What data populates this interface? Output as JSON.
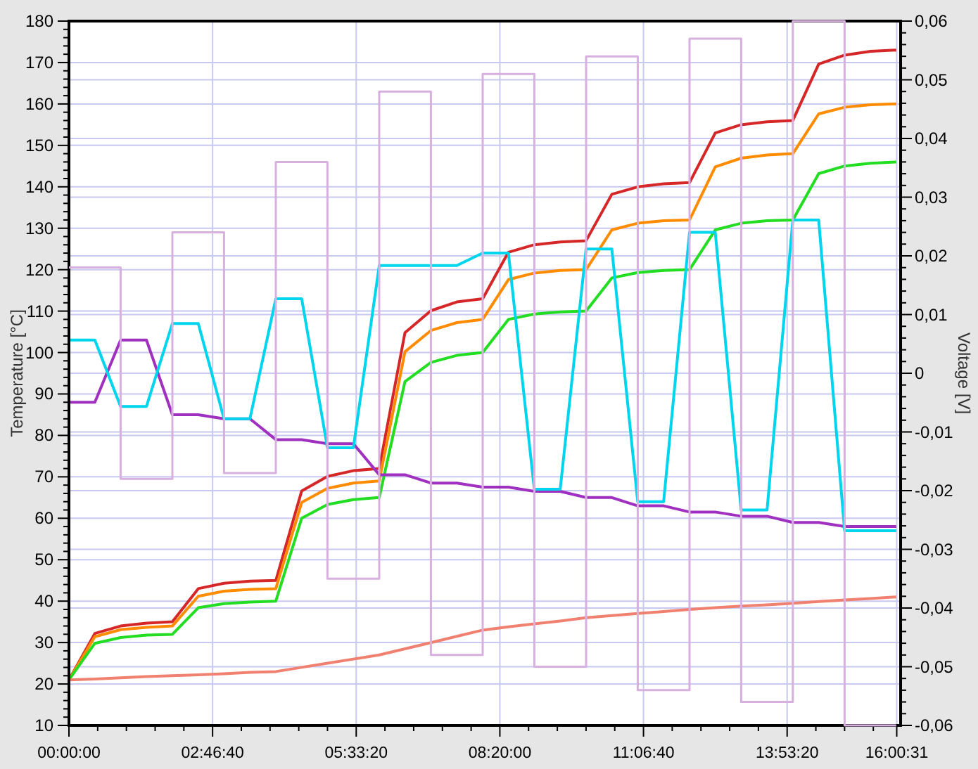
{
  "temperature_chart": {
    "chart_data": {
      "type": "line",
      "ylabel": "Temperature [°C]",
      "x": [
        0,
        1800,
        3600,
        5400,
        7200,
        9000,
        10800,
        12600,
        14400,
        16200,
        18000,
        19800,
        21600,
        23400,
        25200,
        27000,
        28800,
        30600,
        32400,
        34200,
        36000,
        37800,
        39600,
        41400,
        43200,
        45000,
        46800,
        48600,
        50400,
        52200,
        54000,
        55800,
        57600
      ],
      "xlim": [
        0,
        57900
      ],
      "ylim": [
        10,
        180
      ],
      "grid": true,
      "xticks": [
        {
          "value": 0,
          "label": "00:00:00"
        },
        {
          "value": 10000,
          "label": "02:46:40"
        },
        {
          "value": 20000,
          "label": "05:33:20"
        },
        {
          "value": 30000,
          "label": "08:20:00"
        },
        {
          "value": 40000,
          "label": "11:06:40"
        },
        {
          "value": 50000,
          "label": "13:53:20"
        },
        {
          "value": 57631,
          "label": "16:00:31"
        }
      ],
      "yticks": [
        10,
        20,
        30,
        40,
        50,
        60,
        70,
        80,
        90,
        100,
        110,
        120,
        130,
        140,
        150,
        160,
        170,
        180
      ],
      "series": [
        {
          "color": "#d62728",
          "values": [
            21,
            32.2,
            34,
            34.7,
            35,
            43,
            44.3,
            44.8,
            45,
            66.6,
            70.1,
            71.5,
            72,
            104.8,
            110.1,
            112.2,
            113,
            124.2,
            126,
            126.7,
            127,
            138.2,
            140,
            140.7,
            141,
            153,
            155,
            155.7,
            156,
            169.6,
            171.8,
            172.7,
            173
          ]
        },
        {
          "color": "#ff8c00",
          "values": [
            21,
            31.4,
            33.1,
            33.7,
            34,
            41.2,
            42.4,
            42.8,
            43,
            63.8,
            67.2,
            68.5,
            69,
            100.2,
            105.3,
            107.2,
            108,
            117.6,
            119.2,
            119.8,
            120,
            129.6,
            131.2,
            131.8,
            132,
            144.8,
            146.9,
            147.7,
            148,
            157.6,
            159.2,
            159.8,
            160
          ]
        },
        {
          "color": "#22dd22",
          "values": [
            21,
            29.8,
            31.2,
            31.8,
            32,
            38.4,
            39.4,
            39.8,
            40,
            60,
            63.3,
            64.5,
            65,
            93,
            97.6,
            99.3,
            100,
            108,
            109.3,
            109.8,
            110,
            118,
            119.3,
            119.8,
            120,
            129.6,
            131.2,
            131.8,
            132,
            143.2,
            145,
            145.7,
            146
          ]
        },
        {
          "color": "#f08070",
          "values": [
            21,
            21.2,
            21.5,
            21.8,
            22,
            22.2,
            22.5,
            22.8,
            23,
            24,
            25,
            26,
            27,
            28.5,
            30,
            31.5,
            33,
            33.8,
            34.5,
            35.2,
            36,
            36.5,
            37,
            37.5,
            38,
            38.4,
            38.8,
            39.1,
            39.5,
            39.9,
            40.3,
            40.6,
            41
          ]
        },
        {
          "color": "#a030c0",
          "values": [
            88,
            88,
            103,
            103,
            85,
            85,
            84,
            84,
            79,
            79,
            78,
            78,
            70.5,
            70.5,
            68.5,
            68.5,
            67.5,
            67.5,
            66.5,
            66.5,
            65,
            65,
            63,
            63,
            61.5,
            61.5,
            60.5,
            60.5,
            59,
            59,
            58,
            58,
            58
          ]
        },
        {
          "color": "#00d5ee",
          "values": [
            103,
            103,
            87,
            87,
            107,
            107,
            84,
            84,
            113,
            113,
            77,
            77,
            121,
            121,
            121,
            121,
            124,
            124,
            67,
            67,
            125,
            125,
            64,
            64,
            129,
            129,
            62,
            62,
            132,
            132,
            57,
            57,
            57
          ]
        }
      ]
    }
  },
  "voltage_chart": {
    "chart_data": {
      "type": "line",
      "ylabel": "Voltage [V]",
      "x": [
        0,
        3600,
        3600,
        7200,
        7200,
        10800,
        10800,
        14400,
        14400,
        18000,
        18000,
        21600,
        21600,
        25200,
        25200,
        28800,
        28800,
        32400,
        32400,
        36000,
        36000,
        39600,
        39600,
        43200,
        43200,
        46800,
        46800,
        50400,
        50400,
        54000,
        54000,
        57600
      ],
      "xlim": [
        0,
        57900
      ],
      "ylim": [
        -0.06,
        0.06
      ],
      "yticks": [
        {
          "value": 0.06,
          "label": "0,06"
        },
        {
          "value": 0.05,
          "label": "0,05"
        },
        {
          "value": 0.04,
          "label": "0,04"
        },
        {
          "value": 0.03,
          "label": "0,03"
        },
        {
          "value": 0.02,
          "label": "0,02"
        },
        {
          "value": 0.01,
          "label": "0,01"
        },
        {
          "value": 0,
          "label": "0"
        },
        {
          "value": -0.01,
          "label": "-0,01"
        },
        {
          "value": -0.02,
          "label": "-0,02"
        },
        {
          "value": -0.03,
          "label": "-0,03"
        },
        {
          "value": -0.04,
          "label": "-0,04"
        },
        {
          "value": -0.05,
          "label": "-0,05"
        },
        {
          "value": -0.06,
          "label": "-0,06"
        }
      ],
      "series": [
        {
          "color": "#d8b0e0",
          "values": [
            0.018,
            0.018,
            -0.018,
            -0.018,
            0.024,
            0.024,
            -0.017,
            -0.017,
            0.036,
            0.036,
            -0.035,
            -0.035,
            0.048,
            0.048,
            -0.048,
            -0.048,
            0.051,
            0.051,
            -0.05,
            -0.05,
            0.054,
            0.054,
            -0.054,
            -0.054,
            0.057,
            0.057,
            -0.056,
            -0.056,
            0.06,
            0.06,
            -0.06,
            -0.06
          ]
        }
      ]
    }
  }
}
